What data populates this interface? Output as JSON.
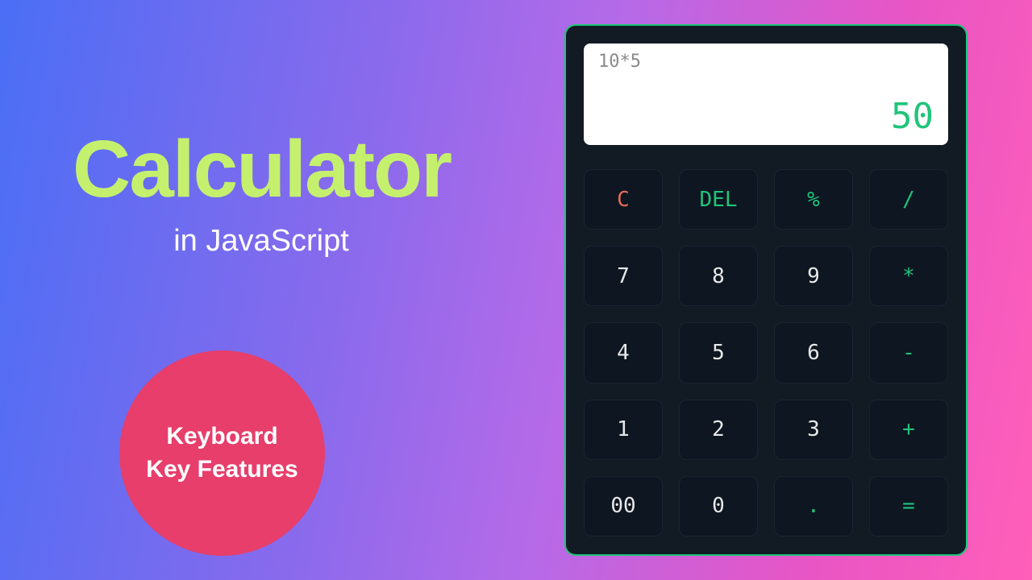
{
  "hero": {
    "title": "Calculator",
    "subtitle": "in JavaScript"
  },
  "badge": {
    "line1": "Keyboard",
    "line2": "Key Features"
  },
  "calculator": {
    "expression": "10*5",
    "result": "50",
    "keys": {
      "clear": "C",
      "delete": "DEL",
      "percent": "%",
      "divide": "/",
      "seven": "7",
      "eight": "8",
      "nine": "9",
      "multiply": "*",
      "four": "4",
      "five": "5",
      "six": "6",
      "subtract": "-",
      "one": "1",
      "two": "2",
      "three": "3",
      "add": "+",
      "double_zero": "00",
      "zero": "0",
      "decimal": ".",
      "equals": "="
    }
  },
  "colors": {
    "accent_green": "#1fc47a",
    "title_green": "#c5f06e",
    "badge_pink": "#e73e6b",
    "key_clear": "#e56a5a",
    "calc_bg": "#121A24"
  }
}
